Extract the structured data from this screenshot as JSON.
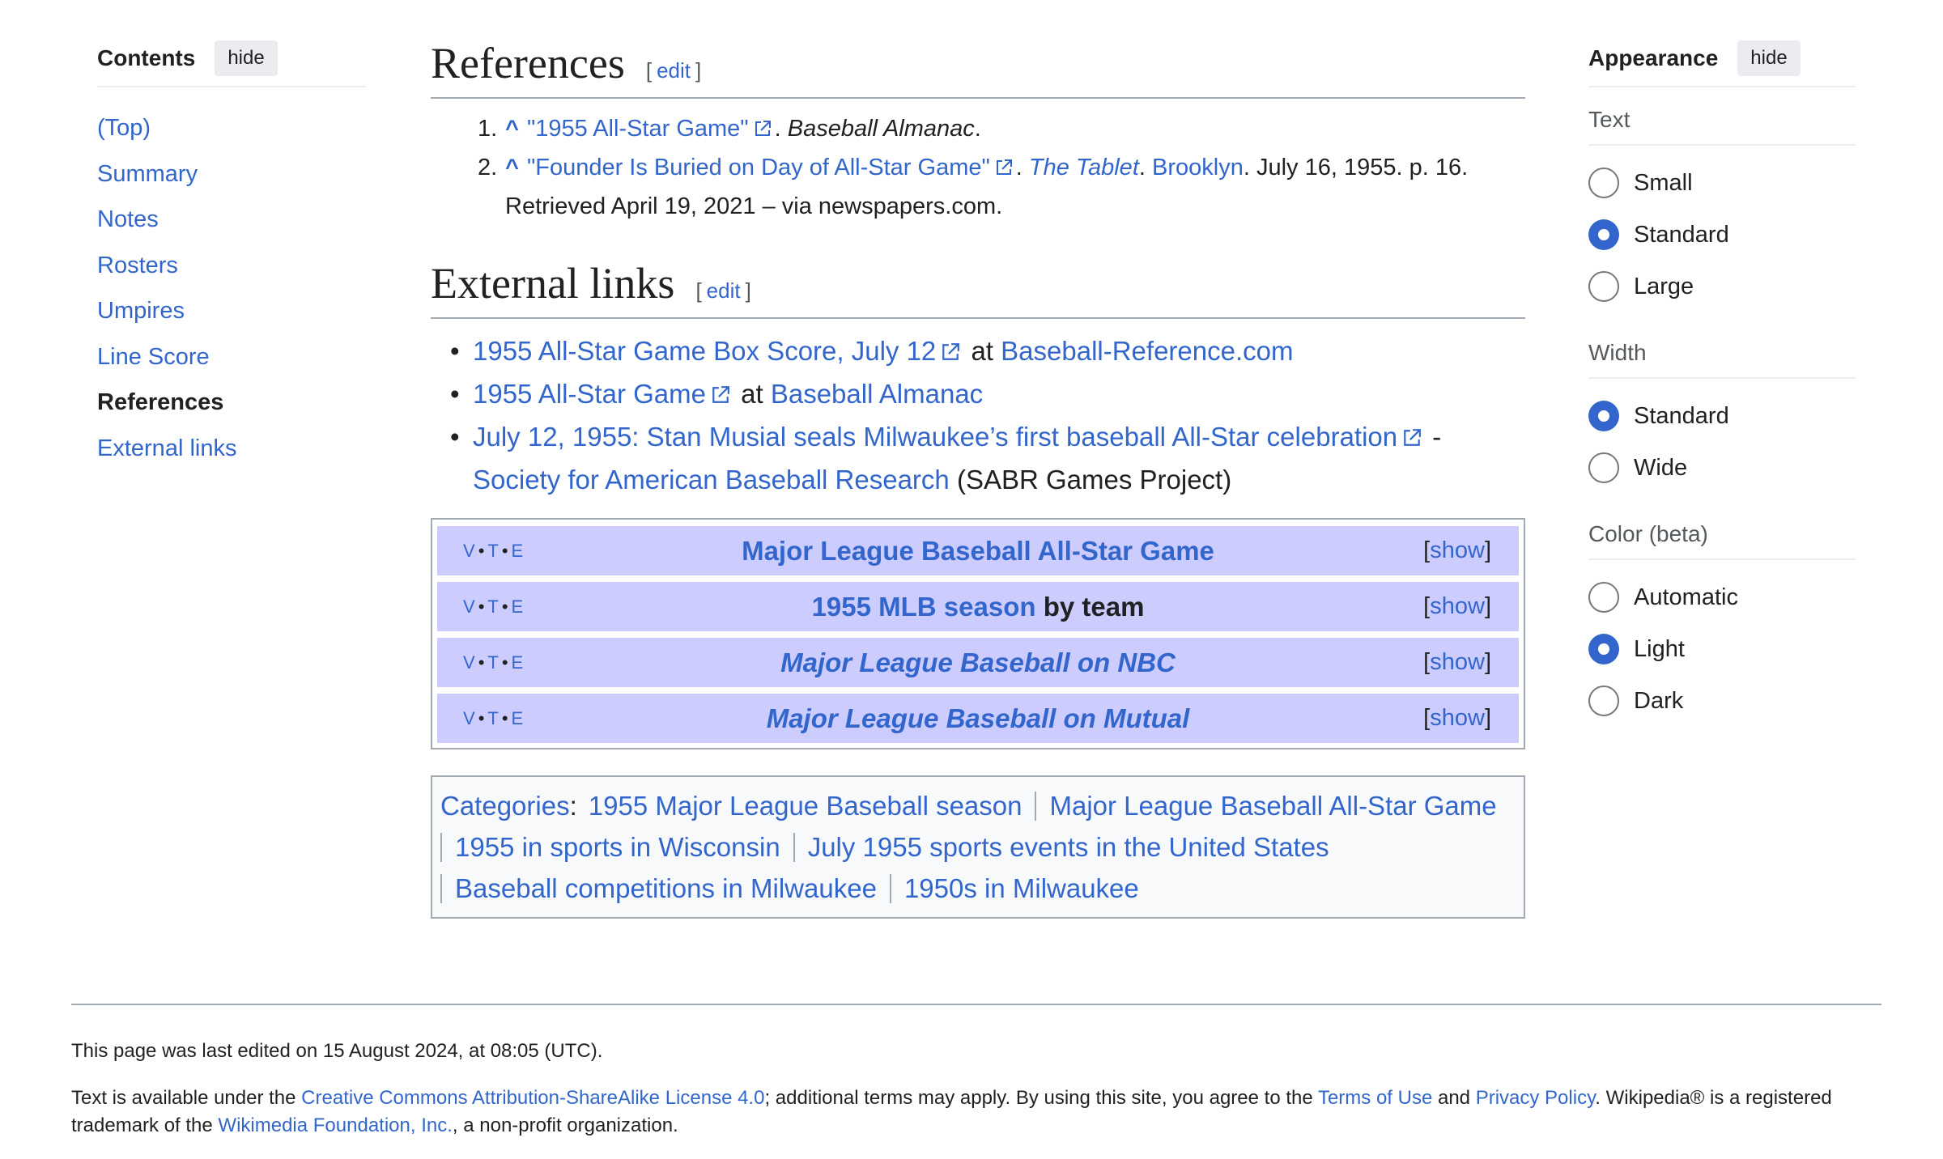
{
  "toc": {
    "title": "Contents",
    "hide_label": "hide",
    "items": [
      "(Top)",
      "Summary",
      "Notes",
      "Rosters",
      "Umpires",
      "Line Score",
      "References",
      "External links"
    ]
  },
  "references": {
    "heading": "References",
    "edit_open": "[",
    "edit_label": "edit",
    "edit_close": "]",
    "items": [
      {
        "num": "1.",
        "caret": "^",
        "title": "\"1955 All-Star Game\"",
        "after": ". ",
        "source": "Baseball Almanac",
        "end": "."
      },
      {
        "num": "2.",
        "caret": "^",
        "title": "\"Founder Is Buried on Day of All-Star Game\"",
        "after": ". ",
        "source": "The Tablet",
        "sep": ". ",
        "place": "Brooklyn",
        "details": ". July 16, 1955. p. 16. Retrieved April 19, 2021 – via newspapers.com."
      }
    ]
  },
  "external_links": {
    "heading": "External links",
    "edit_open": "[",
    "edit_label": "edit",
    "edit_close": "]",
    "items": [
      {
        "link": "1955 All-Star Game Box Score, July 12",
        "mid": " at ",
        "site": "Baseball-Reference.com"
      },
      {
        "link": "1955 All-Star Game",
        "mid": " at ",
        "site": "Baseball Almanac"
      },
      {
        "link": "July 12, 1955: Stan Musial seals Milwaukee’s first baseball All-Star celebration",
        "mid": " - ",
        "site": "Society for American Baseball Research",
        "tail": " (SABR Games Project)"
      }
    ]
  },
  "navboxes": {
    "v": "V",
    "t": "T",
    "e": "E",
    "dot": "•",
    "toggle_open": "[",
    "toggle_label": "show",
    "toggle_close": "]",
    "items": [
      {
        "title": "Major League Baseball All-Star Game",
        "rest": ""
      },
      {
        "title": "1955 MLB season",
        "rest": " by team"
      },
      {
        "title": "Major League Baseball on NBC",
        "rest": ""
      },
      {
        "title": "Major League Baseball on Mutual",
        "rest": ""
      }
    ]
  },
  "categories": {
    "label": "Categories",
    "colon": ":",
    "items": [
      "1955 Major League Baseball season",
      "Major League Baseball All-Star Game",
      "1955 in sports in Wisconsin",
      "July 1955 sports events in the United States",
      "Baseball competitions in Milwaukee",
      "1950s in Milwaukee"
    ]
  },
  "appearance": {
    "title": "Appearance",
    "hide_label": "hide",
    "text": {
      "label": "Text",
      "options": [
        "Small",
        "Standard",
        "Large"
      ],
      "selected": "Standard"
    },
    "width": {
      "label": "Width",
      "options": [
        "Standard",
        "Wide"
      ],
      "selected": "Standard"
    },
    "color": {
      "label": "Color (beta)",
      "options": [
        "Automatic",
        "Light",
        "Dark"
      ],
      "selected": "Light"
    }
  },
  "footer": {
    "last_edited": "This page was last edited on 15 August 2024, at 08:05 (UTC).",
    "l1": "Text is available under the ",
    "license": "Creative Commons Attribution-ShareAlike License 4.0",
    "l2": "; additional terms may apply. By using this site, you agree to the ",
    "terms": "Terms of Use",
    "l3": " and ",
    "privacy": "Privacy Policy",
    "l4": ". Wikipedia® is a registered trademark of the ",
    "foundation": "Wikimedia Foundation, Inc.",
    "l5": ", a non-profit organization."
  },
  "colors": {
    "link": "#3366cc",
    "navbox_bg": "#ccccff",
    "radio_selected": "#3366cc",
    "border": "#a2a9b1"
  },
  "icons": {
    "external_link": "external-link-icon"
  }
}
